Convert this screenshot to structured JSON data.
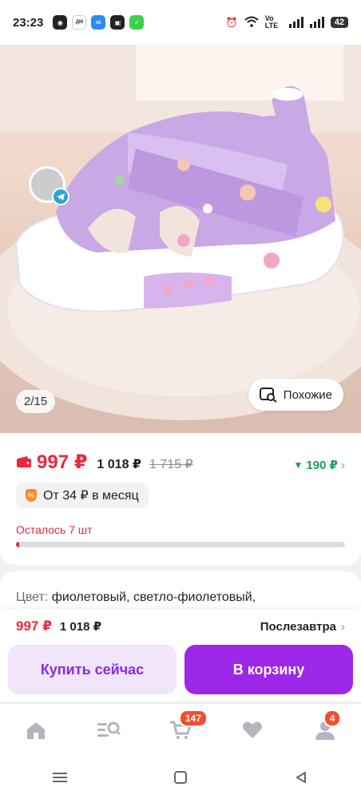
{
  "status_bar": {
    "time": "23:23",
    "network": "Vo LTE",
    "battery": "42"
  },
  "gallery": {
    "pager": "2/15",
    "similar_label": "Похожие",
    "shoe_color": "#c9a8e6"
  },
  "price": {
    "main": "997 ₽",
    "second": "1 018 ₽",
    "old": "1 715 ₽",
    "cashback": "190 ₽",
    "installment": "От 34 ₽ в месяц",
    "remaining": "Осталось 7 шт",
    "stock_progress": 0.01
  },
  "details": {
    "color_label": "Цвет:",
    "color_value": "фиолетовый, светло-фиолетовый,"
  },
  "bottom_actions": {
    "price": "997 ₽",
    "price_second": "1 018 ₽",
    "delivery": "Послезавтра",
    "buy_now": "Купить сейчас",
    "add_to_cart": "В корзину"
  },
  "tabbar": {
    "cart_badge": "147",
    "profile_badge": "4"
  },
  "colors": {
    "accent": "#9c27e8",
    "price_red": "#f0263c",
    "cashback_green": "#1d9e5a"
  }
}
